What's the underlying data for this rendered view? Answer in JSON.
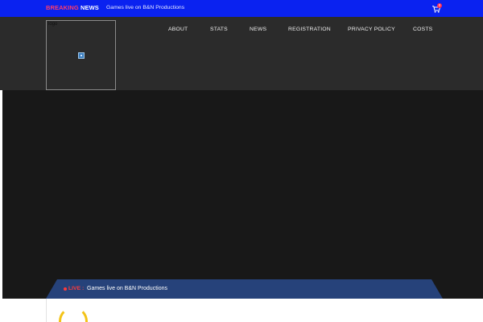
{
  "topbar": {
    "breaking_word1": "BREAKING",
    "breaking_word2": "NEWS",
    "ticker_text": "Games live on B&N Productions",
    "cart_count": "0"
  },
  "header": {
    "logo_alt": "logo",
    "nav": [
      {
        "label": "ABOUT"
      },
      {
        "label": "STATS"
      },
      {
        "label": "NEWS"
      },
      {
        "label": "REGISTRATION"
      },
      {
        "label": "PRIVACY POLICY"
      },
      {
        "label": "COSTS"
      }
    ]
  },
  "hero": {
    "live_label": "LIVE :",
    "live_text": "Games live on B&N Productions"
  },
  "colors": {
    "topbar_bg": "#0a22f0",
    "breaking_accent": "#ff3d6a",
    "header_bg": "#2b2b2b",
    "hero_bg": "#181818",
    "live_bar_bg": "#26427a",
    "live_red": "#ff3b3b",
    "spinner_yellow": "#f3c318"
  },
  "icons": {
    "cart": "shopping-cart-icon",
    "logo": "broken-image-icon",
    "live": "live-dot-icon",
    "loader": "loading-spinner-icon"
  }
}
